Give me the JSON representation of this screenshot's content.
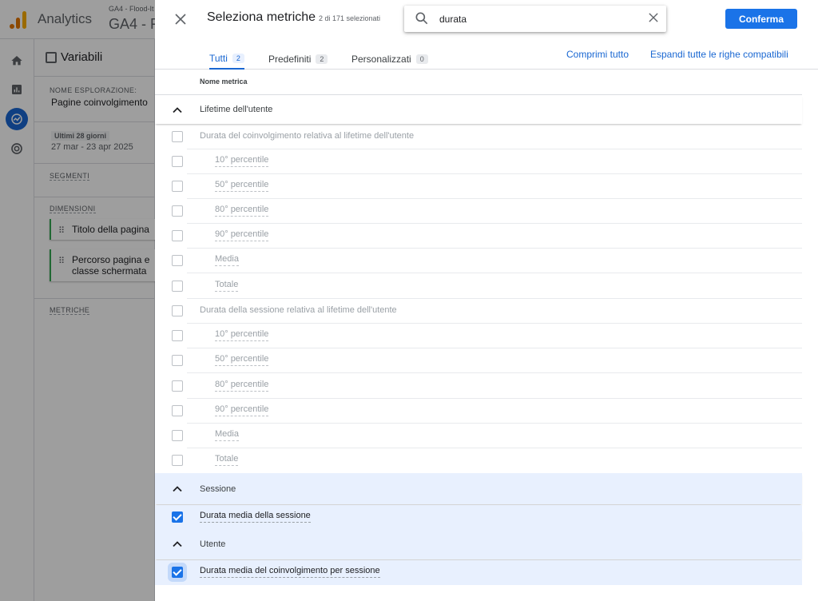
{
  "app": {
    "name": "Analytics",
    "account_path": "GA4 - Flood-It",
    "property": "GA4 - F"
  },
  "variables_panel": {
    "title": "Variabili",
    "exploration_name_label": "NOME ESPLORAZIONE:",
    "exploration_name": "Pagine coinvolgimento",
    "date_range_label": "Ultimi 28 giorni",
    "date_range": "27 mar - 23 apr 2025",
    "segments_label": "SEGMENTI",
    "dimensions_label": "DIMENSIONI",
    "dimensions": [
      "Titolo della pagina",
      "Percorso pagina e classe schermata"
    ],
    "metrics_label": "METRICHE"
  },
  "modal": {
    "title": "Seleziona metriche",
    "selected_count": "2 di 171 selezionati",
    "search_value": "durata",
    "confirm_label": "Conferma",
    "tabs": [
      {
        "label": "Tutti",
        "count": "2",
        "active": true
      },
      {
        "label": "Predefiniti",
        "count": "2",
        "active": false
      },
      {
        "label": "Personalizzati",
        "count": "0",
        "active": false
      }
    ],
    "collapse_all": "Comprimi tutto",
    "expand_all": "Espandi tutte le righe compatibili",
    "column_header": "Nome metrica",
    "groups": [
      {
        "name": "Lifetime dell'utente",
        "items": [
          {
            "label": "Durata del coinvolgimento relativa al lifetime dell'utente",
            "checked": false,
            "disabled": true,
            "children": [
              "10° percentile",
              "50° percentile",
              "80° percentile",
              "90° percentile",
              "Media",
              "Totale"
            ]
          },
          {
            "label": "Durata della sessione relativa al lifetime dell'utente",
            "checked": false,
            "disabled": true,
            "children": [
              "10° percentile",
              "50° percentile",
              "80° percentile",
              "90° percentile",
              "Media",
              "Totale"
            ]
          }
        ]
      },
      {
        "name": "Sessione",
        "items": [
          {
            "label": "Durata media della sessione",
            "checked": true
          }
        ]
      },
      {
        "name": "Utente",
        "items": [
          {
            "label": "Durata media del coinvolgimento per sessione",
            "checked": true
          }
        ]
      }
    ]
  },
  "colors": {
    "primary": "#1a73e8",
    "selected_row_bg": "#e8f0fe",
    "disabled_text": "#9aa0a6",
    "dimension_accent": "#34a853"
  },
  "icons": {
    "close": "close-icon",
    "search": "search-icon",
    "clear": "clear-icon",
    "expand": "chevron-up-icon",
    "drag": "drag-handle-icon"
  }
}
